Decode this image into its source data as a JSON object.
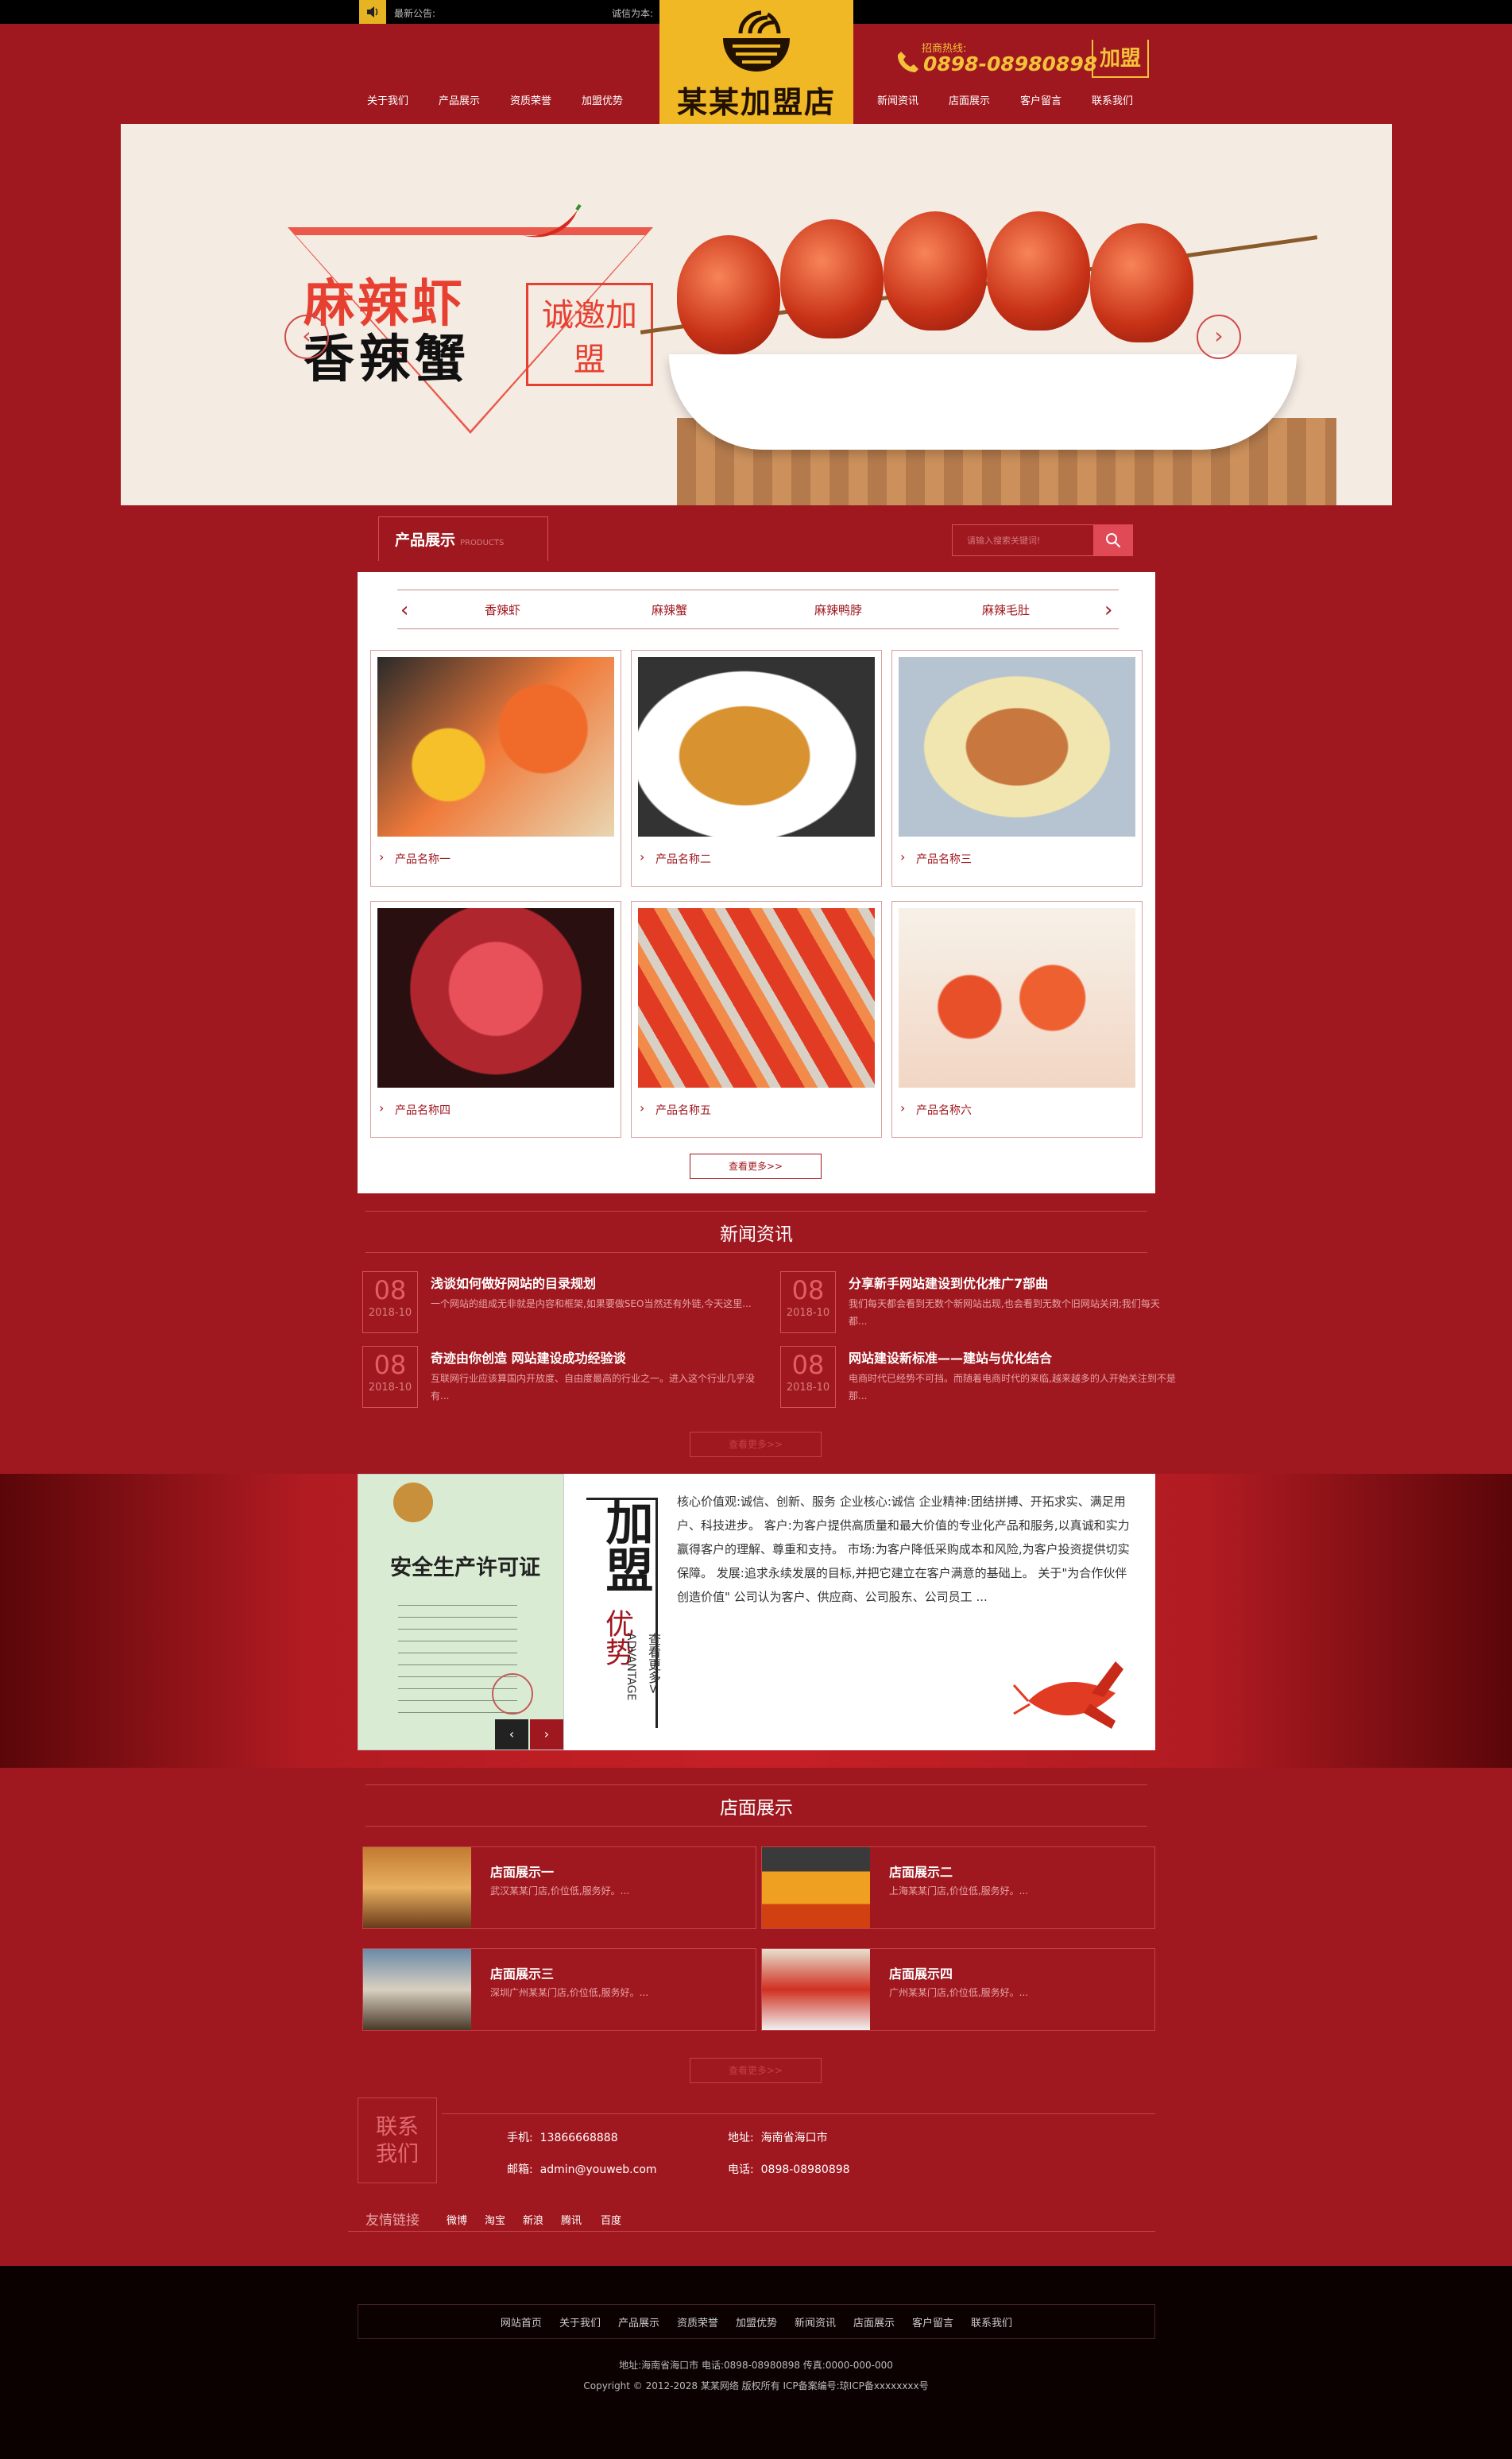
{
  "topbar": {
    "notice": "最新公告:",
    "slogan": "诚信为本:"
  },
  "nav_left": [
    "关于我们",
    "产品展示",
    "资质荣誉",
    "加盟优势"
  ],
  "nav_right": [
    "新闻资讯",
    "店面展示",
    "客户留言",
    "联系我们"
  ],
  "logo": {
    "text": "某某加盟店"
  },
  "hotline": {
    "label": "招商热线:",
    "number": "0898-08980898",
    "join": "加盟"
  },
  "banner": {
    "line1": "麻辣虾",
    "line2": "香辣蟹",
    "invite": "诚邀加盟",
    "prev": "‹",
    "next": "›"
  },
  "products": {
    "title": "产品展示",
    "title_en": "PRODUCTS",
    "search_placeholder": "请输入搜索关键词!",
    "tabs": [
      "香辣虾",
      "麻辣蟹",
      "麻辣鸭脖",
      "麻辣毛肚"
    ],
    "items": [
      "产品名称一",
      "产品名称二",
      "产品名称三",
      "产品名称四",
      "产品名称五",
      "产品名称六"
    ],
    "more": "查看更多>>"
  },
  "news": {
    "title": "新闻资讯",
    "items": [
      {
        "day": "08",
        "ym": "2018-10",
        "title": "浅谈如何做好网站的目录规划",
        "desc": "一个网站的组成无非就是内容和框架,如果要做SEO当然还有外链,今天这里..."
      },
      {
        "day": "08",
        "ym": "2018-10",
        "title": "分享新手网站建设到优化推广7部曲",
        "desc": "我们每天都会看到无数个新网站出现,也会看到无数个旧网站关闭;我们每天都..."
      },
      {
        "day": "08",
        "ym": "2018-10",
        "title": "奇迹由你创造 网站建设成功经验谈",
        "desc": "互联网行业应该算国内开放度、自由度最高的行业之一。进入这个行业几乎没有..."
      },
      {
        "day": "08",
        "ym": "2018-10",
        "title": "网站建设新标准——建站与优化结合",
        "desc": "电商时代已经势不可挡。而随着电商时代的来临,越来越多的人开始关注到不是那..."
      }
    ],
    "more": "查看更多>>"
  },
  "advantage": {
    "cert_title": "安全生产许可证",
    "title1": "加盟",
    "title2": "优势",
    "en": "ADVANTAGE",
    "more": "查看更多>",
    "text": "核心价值观:诚信、创新、服务 企业核心:诚信 企业精神:团结拼搏、开拓求实、满足用户、科技进步。 客户:为客户提供高质量和最大价值的专业化产品和服务,以真诚和实力赢得客户的理解、尊重和支持。 市场:为客户降低采购成本和风险,为客户投资提供切实保障。 发展:追求永续发展的目标,并把它建立在客户满意的基础上。 关于\"为合作伙伴创造价值\" 公司认为客户、供应商、公司股东、公司员工 ..."
  },
  "stores": {
    "title": "店面展示",
    "items": [
      {
        "title": "店面展示一",
        "desc": "武汉某某门店,价位低,服务好。..."
      },
      {
        "title": "店面展示二",
        "desc": "上海某某门店,价位低,服务好。..."
      },
      {
        "title": "店面展示三",
        "desc": "深圳广州某某门店,价位低,服务好。..."
      },
      {
        "title": "店面展示四",
        "desc": "广州某某门店,价位低,服务好。..."
      }
    ],
    "more": "查看更多>>"
  },
  "contact": {
    "title1": "联系",
    "title2": "我们",
    "phone_label": "手机:",
    "phone": "13866668888",
    "addr_label": "地址:",
    "addr": "海南省海口市",
    "email_label": "邮箱:",
    "email": "admin@youweb.com",
    "tel_label": "电话:",
    "tel": "0898-08980898"
  },
  "links": {
    "title": "友情链接",
    "items": [
      "微博",
      "淘宝",
      "新浪",
      "腾讯",
      "百度"
    ]
  },
  "footer": {
    "nav": [
      "网站首页",
      "关于我们",
      "产品展示",
      "资质荣誉",
      "加盟优势",
      "新闻资讯",
      "店面展示",
      "客户留言",
      "联系我们"
    ],
    "info": "地址:海南省海口市 电话:0898-08980898 传真:0000-000-000",
    "copyright": "Copyright © 2012-2028 某某网络 版权所有 ICP备案编号:琼ICP备xxxxxxxx号"
  },
  "colors": {
    "primary": "#a0181f",
    "gold": "#f0b825",
    "footer": "#0c0101"
  }
}
